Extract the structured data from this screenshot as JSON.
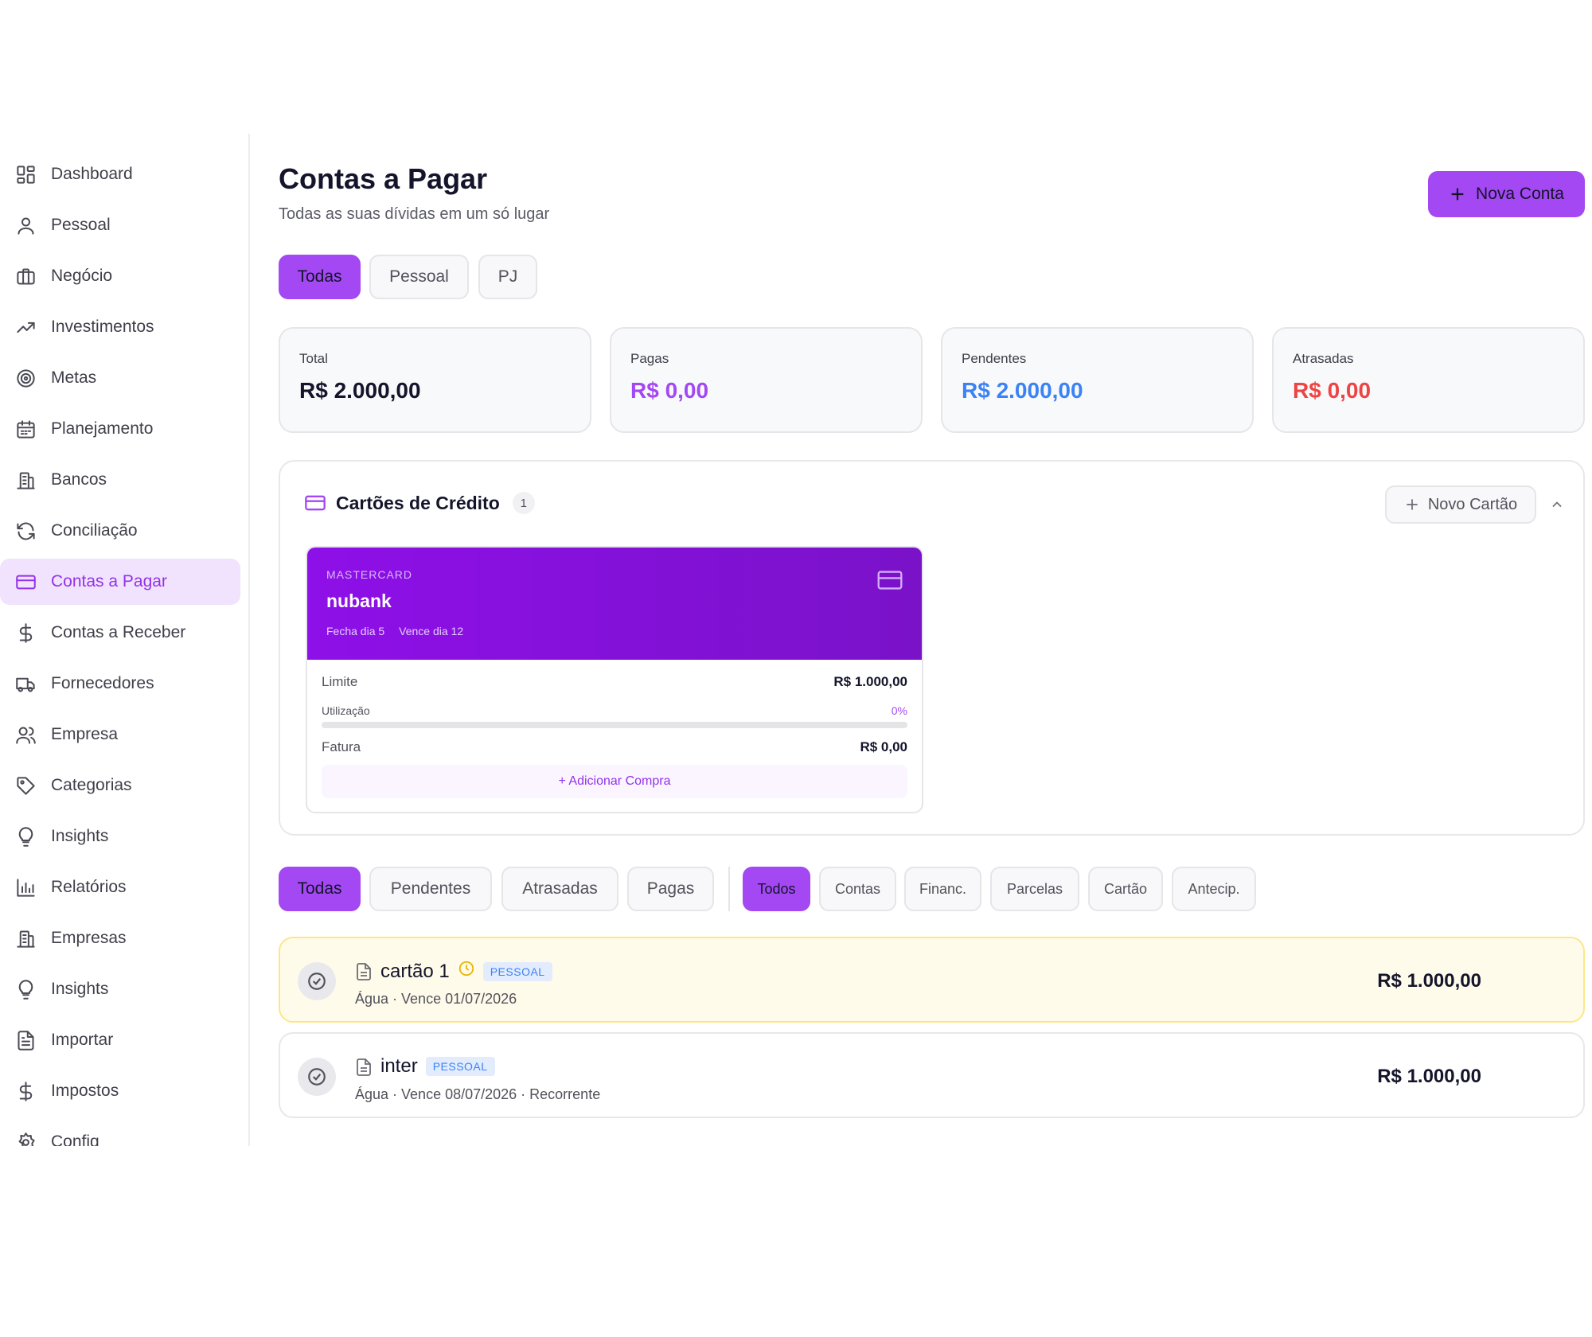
{
  "sidebar": {
    "items": [
      {
        "label": "Dashboard",
        "icon": "dashboard-icon",
        "active": false
      },
      {
        "label": "Pessoal",
        "icon": "user-icon",
        "active": false
      },
      {
        "label": "Negócio",
        "icon": "briefcase-icon",
        "active": false
      },
      {
        "label": "Investimentos",
        "icon": "trending-up-icon",
        "active": false
      },
      {
        "label": "Metas",
        "icon": "target-icon",
        "active": false
      },
      {
        "label": "Planejamento",
        "icon": "calendar-icon",
        "active": false
      },
      {
        "label": "Bancos",
        "icon": "bank-icon",
        "active": false
      },
      {
        "label": "Conciliação",
        "icon": "refresh-icon",
        "active": false
      },
      {
        "label": "Contas a Pagar",
        "icon": "credit-card-icon",
        "active": true
      },
      {
        "label": "Contas a Receber",
        "icon": "dollar-icon",
        "active": false
      },
      {
        "label": "Fornecedores",
        "icon": "truck-icon",
        "active": false
      },
      {
        "label": "Empresa",
        "icon": "users-icon",
        "active": false
      },
      {
        "label": "Categorias",
        "icon": "tag-icon",
        "active": false
      },
      {
        "label": "Insights",
        "icon": "lightbulb-icon",
        "active": false
      },
      {
        "label": "Relatórios",
        "icon": "bar-chart-icon",
        "active": false
      },
      {
        "label": "Empresas",
        "icon": "building-icon",
        "active": false
      },
      {
        "label": "Insights",
        "icon": "lightbulb-icon",
        "active": false
      },
      {
        "label": "Importar",
        "icon": "file-icon",
        "active": false
      },
      {
        "label": "Impostos",
        "icon": "dollar-icon",
        "active": false
      },
      {
        "label": "Config",
        "icon": "gear-icon",
        "active": false
      }
    ]
  },
  "header": {
    "title": "Contas a Pagar",
    "subtitle": "Todas as suas dívidas em um só lugar",
    "new_button": "Nova Conta"
  },
  "scope_tabs": [
    "Todas",
    "Pessoal",
    "PJ"
  ],
  "stats": [
    {
      "label": "Total",
      "value": "R$ 2.000,00",
      "color": "#14142b"
    },
    {
      "label": "Pagas",
      "value": "R$ 0,00",
      "color": "#a348f2"
    },
    {
      "label": "Pendentes",
      "value": "R$ 2.000,00",
      "color": "#3b82f6"
    },
    {
      "label": "Atrasadas",
      "value": "R$ 0,00",
      "color": "#ef4444"
    }
  ],
  "cards_section": {
    "title": "Cartões de Crédito",
    "count": "1",
    "new_card_button": "Novo Cartão",
    "card": {
      "brand": "MASTERCARD",
      "name": "nubank",
      "closes": "Fecha dia 5",
      "due": "Vence dia 12",
      "limit_label": "Limite",
      "limit_value": "R$ 1.000,00",
      "usage_label": "Utilização",
      "usage_value": "0%",
      "usage_fraction": 0,
      "invoice_label": "Fatura",
      "invoice_value": "R$ 0,00",
      "add_purchase": "+ Adicionar Compra"
    }
  },
  "status_filters": [
    "Todas",
    "Pendentes",
    "Atrasadas",
    "Pagas"
  ],
  "type_filters": [
    "Todos",
    "Contas",
    "Financ.",
    "Parcelas",
    "Cartão",
    "Antecip."
  ],
  "bills": [
    {
      "name": "cartão 1",
      "tag": "PESSOAL",
      "meta": "Água · Vence 01/07/2026",
      "amount": "R$ 1.000,00",
      "warning": true
    },
    {
      "name": "inter",
      "tag": "PESSOAL",
      "meta": "Água · Vence 08/07/2026 · Recorrente",
      "amount": "R$ 1.000,00",
      "warning": false
    }
  ]
}
